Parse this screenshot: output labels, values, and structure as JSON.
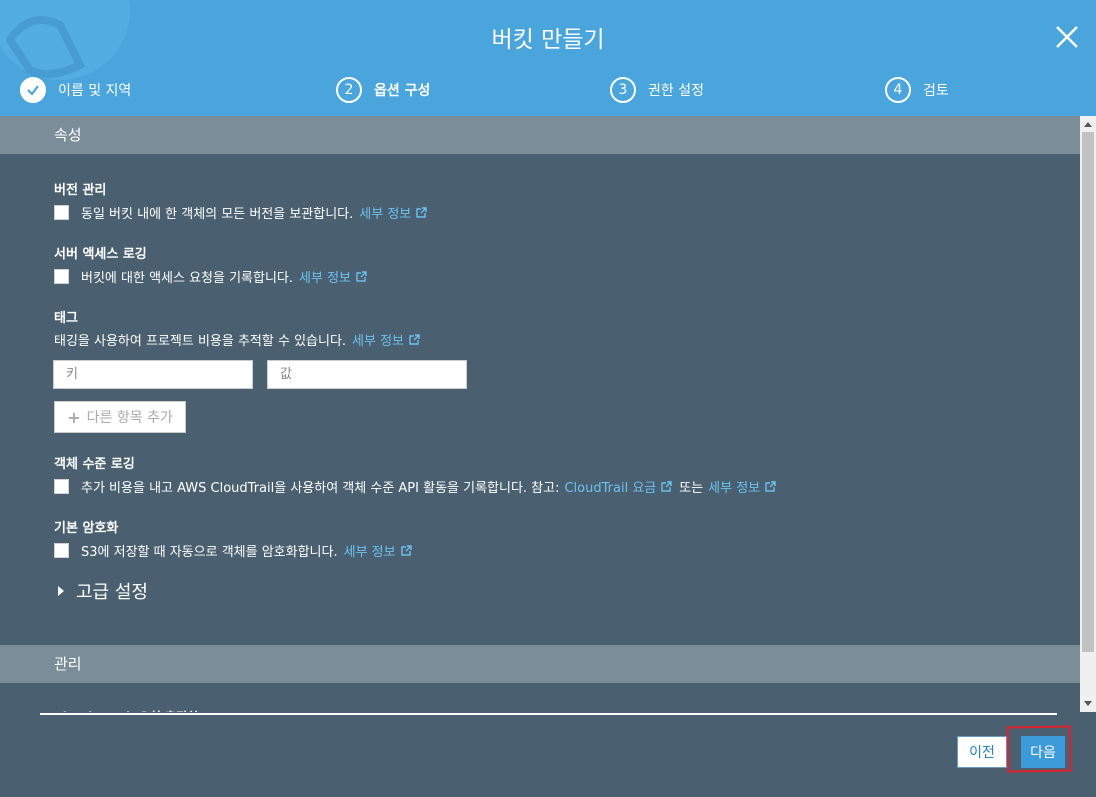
{
  "header": {
    "title": "버킷 만들기",
    "close_icon": "close-icon",
    "steps": [
      {
        "number": "",
        "label": "이름 및 지역",
        "state": "done"
      },
      {
        "number": "2",
        "label": "옵션 구성",
        "state": "active"
      },
      {
        "number": "3",
        "label": "권한 설정",
        "state": "pending"
      },
      {
        "number": "4",
        "label": "검토",
        "state": "pending"
      }
    ]
  },
  "properties": {
    "section_title": "속성",
    "versioning": {
      "title": "버전 관리",
      "text": "동일 버킷 내에 한 객체의 모든 버전을 보관합니다.",
      "link": "세부 정보"
    },
    "logging": {
      "title": "서버 액세스 로깅",
      "text": "버킷에 대한 액세스 요청을 기록합니다.",
      "link": "세부 정보"
    },
    "tags": {
      "title": "태그",
      "text": "태깅을 사용하여 프로젝트 비용을 추적할 수 있습니다.",
      "link": "세부 정보",
      "key_placeholder": "키",
      "value_placeholder": "값",
      "add_label": "다른 항목 추가"
    },
    "object_logging": {
      "title": "객체 수준 로깅",
      "text": "추가 비용을 내고 AWS CloudTrail을 사용하여 객체 수준 API 활동을 기록합니다. 참고:",
      "link1": "CloudTrail 요금",
      "or": "또는",
      "link2": "세부 정보"
    },
    "encryption": {
      "title": "기본 암호화",
      "text": "S3에 저장할 때 자동으로 객체를 암호화합니다.",
      "link": "세부 정보"
    },
    "advanced": "고급 설정"
  },
  "management": {
    "section_title": "관리",
    "clipped_label": "CloudWatch 요청 측정치"
  },
  "footer": {
    "prev_label": "이전",
    "next_label": "다음"
  },
  "colors": {
    "header_bg": "#4aa5dc",
    "body_bg": "#4a6070",
    "section_bg": "#7b8d99",
    "link": "#6cc0f0",
    "primary": "#3d9ad8",
    "annotation": "#e0202a"
  }
}
